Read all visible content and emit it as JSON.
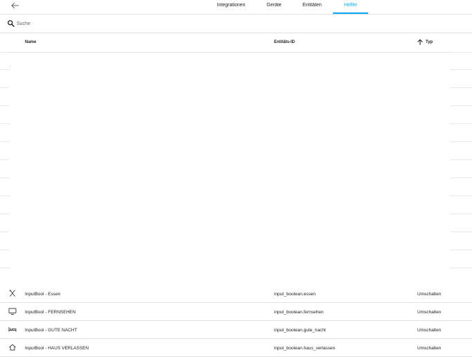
{
  "tabs": [
    {
      "label": "Integrationen",
      "active": false
    },
    {
      "label": "Geräte",
      "active": false
    },
    {
      "label": "Entitäten",
      "active": false
    },
    {
      "label": "Helfer",
      "active": true
    }
  ],
  "accent_color": "#03a9f4",
  "search": {
    "placeholder": "Suche",
    "value": ""
  },
  "table": {
    "columns": {
      "name": "Name",
      "entity_id": "Entitäts-ID",
      "type": "Typ"
    },
    "sort": {
      "column": "Typ",
      "direction": "ascending"
    },
    "rows": [
      {
        "icon": "silverware-icon",
        "name": "InputBool - Essen",
        "entity_id": "input_boolean.essen",
        "type": "Umschalten"
      },
      {
        "icon": "television-icon",
        "name": "InputBool - FERNSEHEN",
        "entity_id": "input_boolean.fernsehen",
        "type": "Umschalten"
      },
      {
        "icon": "bed-icon",
        "name": "InputBool - GUTE NACHT",
        "entity_id": "input_boolean.gute_nacht",
        "type": "Umschalten"
      },
      {
        "icon": "home-icon",
        "name": "InputBool - HAUS VERLASSEN",
        "entity_id": "input_boolean.haus_verlassen",
        "type": "Umschalten"
      }
    ]
  }
}
